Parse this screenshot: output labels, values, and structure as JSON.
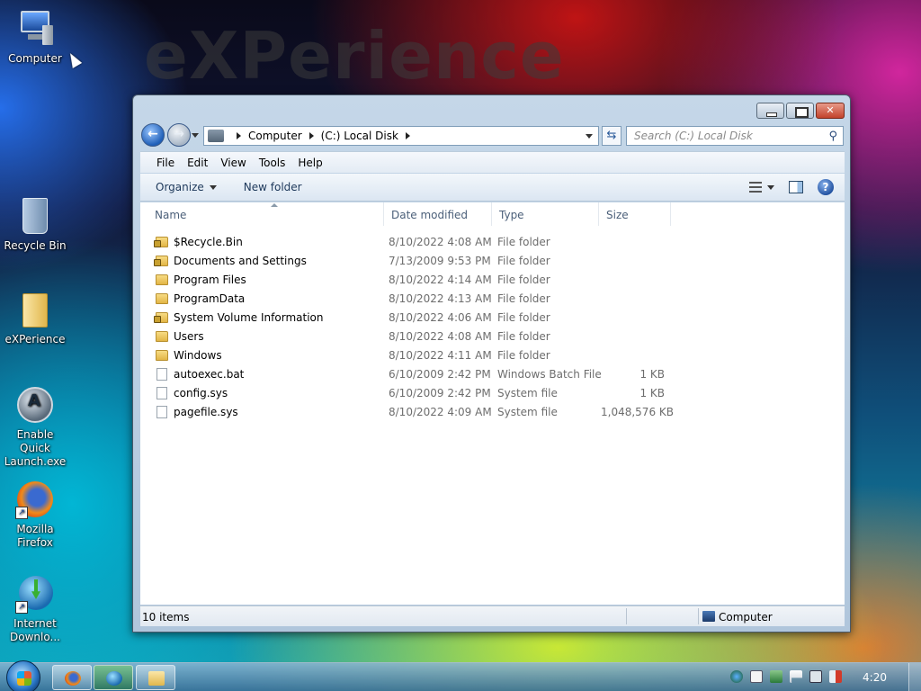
{
  "desktop": {
    "wallpaper_text": "eXPerience",
    "icons": [
      {
        "label": "Computer"
      },
      {
        "label": "Recycle Bin"
      },
      {
        "label": "eXPerience"
      },
      {
        "label": "Enable Quick Launch.exe"
      },
      {
        "label": "Mozilla Firefox"
      },
      {
        "label": "Internet Downlo..."
      }
    ]
  },
  "window": {
    "address": {
      "crumbs": [
        "Computer",
        "(C:) Local Disk"
      ]
    },
    "search": {
      "placeholder": "Search (C:) Local Disk"
    },
    "menu": [
      "File",
      "Edit",
      "View",
      "Tools",
      "Help"
    ],
    "toolbar": {
      "organize": "Organize",
      "new_folder": "New folder"
    },
    "columns": [
      "Name",
      "Date modified",
      "Type",
      "Size"
    ],
    "rows": [
      {
        "name": "$Recycle.Bin",
        "date": "8/10/2022 4:08 AM",
        "type": "File folder",
        "size": "",
        "icon": "locked-folder"
      },
      {
        "name": "Documents and Settings",
        "date": "7/13/2009 9:53 PM",
        "type": "File folder",
        "size": "",
        "icon": "locked-folder"
      },
      {
        "name": "Program Files",
        "date": "8/10/2022 4:14 AM",
        "type": "File folder",
        "size": "",
        "icon": "folder"
      },
      {
        "name": "ProgramData",
        "date": "8/10/2022 4:13 AM",
        "type": "File folder",
        "size": "",
        "icon": "folder"
      },
      {
        "name": "System Volume Information",
        "date": "8/10/2022 4:06 AM",
        "type": "File folder",
        "size": "",
        "icon": "locked-folder"
      },
      {
        "name": "Users",
        "date": "8/10/2022 4:08 AM",
        "type": "File folder",
        "size": "",
        "icon": "folder"
      },
      {
        "name": "Windows",
        "date": "8/10/2022 4:11 AM",
        "type": "File folder",
        "size": "",
        "icon": "folder"
      },
      {
        "name": "autoexec.bat",
        "date": "6/10/2009 2:42 PM",
        "type": "Windows Batch File",
        "size": "1 KB",
        "icon": "file"
      },
      {
        "name": "config.sys",
        "date": "6/10/2009 2:42 PM",
        "type": "System file",
        "size": "1 KB",
        "icon": "file"
      },
      {
        "name": "pagefile.sys",
        "date": "8/10/2022 4:09 AM",
        "type": "System file",
        "size": "1,048,576 KB",
        "icon": "file"
      }
    ],
    "status": {
      "count": "10 items",
      "zone": "Computer"
    }
  },
  "taskbar": {
    "clock": "4:20",
    "tray_icons": [
      "network-icon",
      "notes-icon",
      "security-icon",
      "action-center-flag-icon",
      "display-icon",
      "volume-muted-icon"
    ]
  }
}
